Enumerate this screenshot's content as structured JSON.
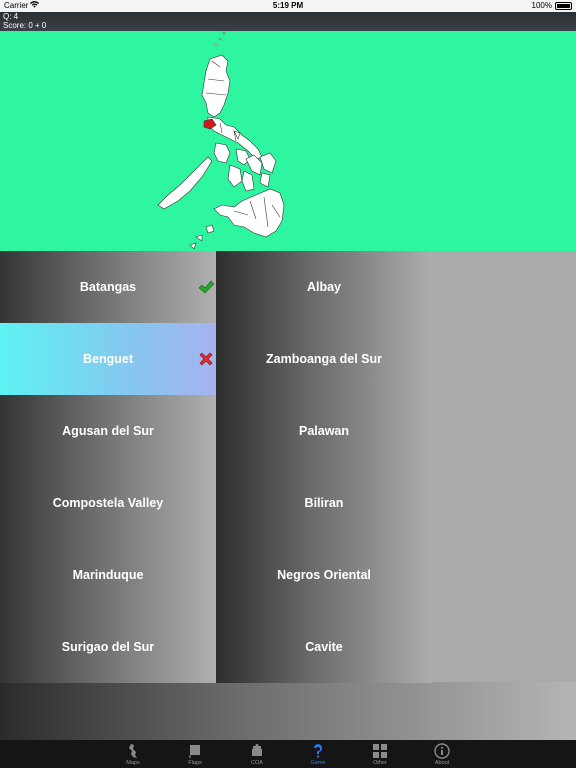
{
  "status_bar": {
    "carrier": "Carrier",
    "time": "5:19 PM",
    "battery": "100%"
  },
  "info": {
    "question": "Q:    4",
    "score": "Score:    0 + 0"
  },
  "colors": {
    "map_background": "#2ef59f",
    "highlight_region": "#d11a1a",
    "check_mark": "#2aa52a",
    "x_mark": "#e02c2c",
    "active_tab": "#2a7cff"
  },
  "answers": {
    "left": [
      {
        "label": "Batangas",
        "mark": "check-icon"
      },
      {
        "label": "Benguet",
        "mark": "x-icon",
        "state": "wrong"
      },
      {
        "label": "Agusan del Sur"
      },
      {
        "label": "Compostela Valley"
      },
      {
        "label": "Marinduque"
      },
      {
        "label": "Surigao del Sur"
      }
    ],
    "right": [
      {
        "label": "Albay"
      },
      {
        "label": "Zamboanga del Sur"
      },
      {
        "label": "Palawan"
      },
      {
        "label": "Biliran"
      },
      {
        "label": "Negros Oriental"
      },
      {
        "label": "Cavite"
      }
    ]
  },
  "tabs": [
    {
      "label": "Maps",
      "icon": "map-icon"
    },
    {
      "label": "Flags",
      "icon": "flag-icon"
    },
    {
      "label": "COA",
      "icon": "crest-icon"
    },
    {
      "label": "Game",
      "icon": "question-icon",
      "active": true
    },
    {
      "label": "Other",
      "icon": "grid-icon"
    },
    {
      "label": "About",
      "icon": "info-icon"
    }
  ]
}
